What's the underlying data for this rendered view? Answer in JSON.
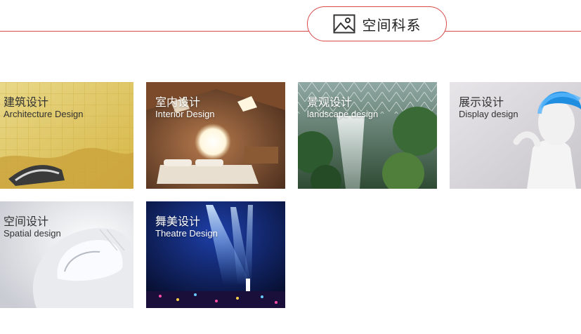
{
  "header": {
    "title": "空间科系",
    "icon": "image-icon",
    "accent_color": "#d94a4a"
  },
  "cards": [
    {
      "cn": "建筑设计",
      "en": "Architecture Design"
    },
    {
      "cn": "室内设计",
      "en": "Interior Design"
    },
    {
      "cn": "景观设计",
      "en": "landscape design"
    },
    {
      "cn": "展示设计",
      "en": "Display design"
    },
    {
      "cn": "空间设计",
      "en": "Spatial design"
    },
    {
      "cn": "舞美设计",
      "en": "Theatre Design"
    }
  ]
}
